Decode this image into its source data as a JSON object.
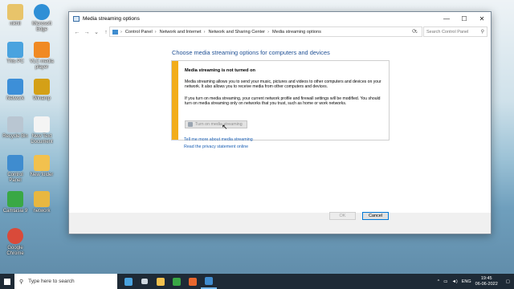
{
  "desktop": {
    "icons": [
      {
        "label": "nikhil",
        "color": "#e8c46a"
      },
      {
        "label": "Microsoft Edge",
        "color": "#2f8fd6"
      },
      {
        "label": "This PC",
        "color": "#4aa3df"
      },
      {
        "label": "VLC media player",
        "color": "#f08a24"
      },
      {
        "label": "Network",
        "color": "#3d8fd8"
      },
      {
        "label": "Winamp",
        "color": "#d4a017"
      },
      {
        "label": "Recycle Bin",
        "color": "#b9c6d2"
      },
      {
        "label": "New Text Document",
        "color": "#f4f4f4"
      },
      {
        "label": "Control Panel",
        "color": "#3f8ccf"
      },
      {
        "label": "New folder",
        "color": "#f2c14e"
      },
      {
        "label": "Camtasia 9",
        "color": "#39a845"
      },
      {
        "label": "network",
        "color": "#e8b740"
      },
      {
        "label": "Google Chrome",
        "color": "#d94a3a"
      }
    ]
  },
  "window": {
    "title": "Media streaming options",
    "controls": {
      "minimize": "—",
      "maximize": "☐",
      "close": "✕"
    },
    "nav": {
      "back": "←",
      "forward": "→",
      "recent": "⌄",
      "up": "↑"
    },
    "breadcrumb": [
      "Control Panel",
      "Network and Internet",
      "Network and Sharing Center",
      "Media streaming options"
    ],
    "search_placeholder": "Search Control Panel",
    "heading": "Choose media streaming options for computers and devices",
    "panel": {
      "title": "Media streaming is not turned on",
      "p1": "Media streaming allows you to send your music, pictures and videos to other computers and devices on your network.  It also allows you to receive media from other computers and devices.",
      "p2": "If you turn on media streaming, your current network profile and firewall settings will be modified. You should turn on media streaming only on networks that you trust, such as home or work networks.",
      "button": "Turn on media streaming"
    },
    "links": [
      "Tell me more about media streaming",
      "Read the privacy statement online"
    ],
    "ok_label": "OK",
    "cancel_label": "Cancel"
  },
  "taskbar": {
    "search_placeholder": "Type here to search",
    "apps": [
      {
        "name": "news-widget",
        "color": "#4aa3df"
      },
      {
        "name": "task-view",
        "color": "#cfd8e0"
      },
      {
        "name": "file-explorer",
        "color": "#f2c14e"
      },
      {
        "name": "camtasia",
        "color": "#39a845"
      },
      {
        "name": "recorder",
        "color": "#e8672d"
      },
      {
        "name": "control-panel",
        "color": "#3f8ccf"
      }
    ],
    "tray": {
      "language": "ENG",
      "time": "19:45",
      "date": "06-06-2022"
    }
  }
}
